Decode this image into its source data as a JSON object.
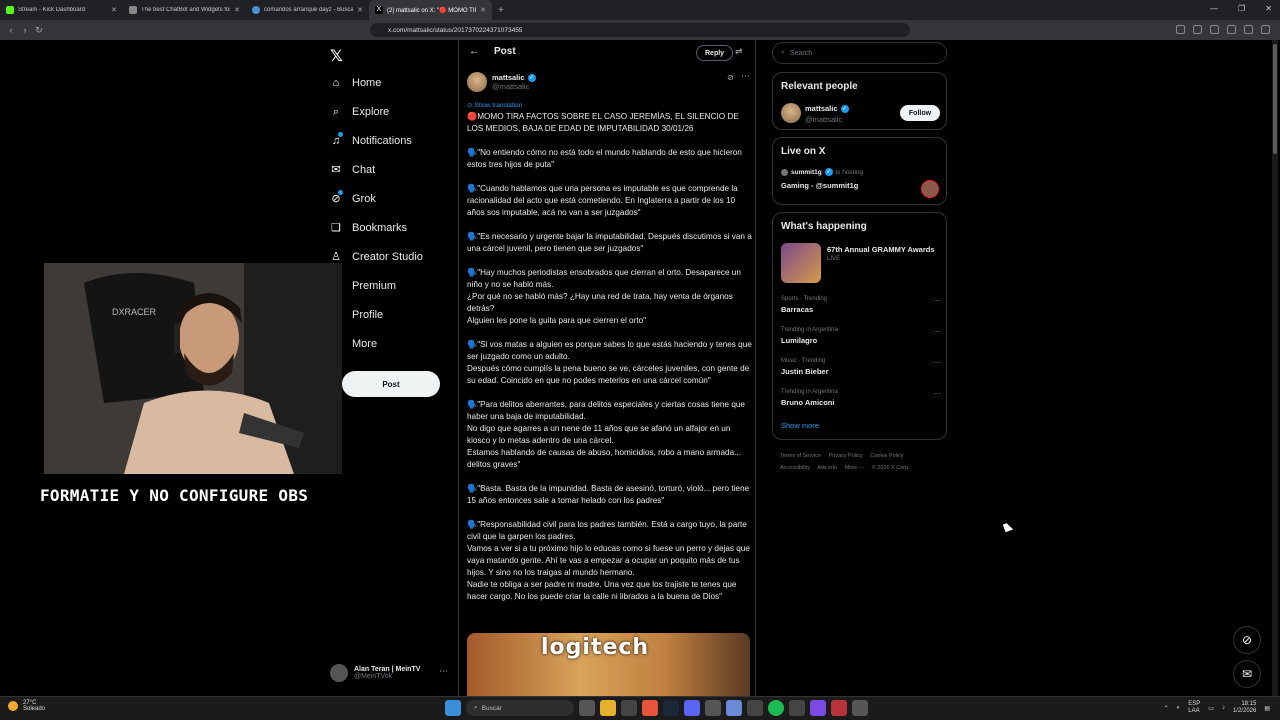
{
  "browser": {
    "tabs": [
      {
        "title": "Stream - Kick Dashboard",
        "color": "#53fc18"
      },
      {
        "title": "The best ChatBot and Widgets for K…",
        "color": "#888888"
      },
      {
        "title": "comandos arranque dayz - Buscar c…",
        "color": "#4a90d9"
      },
      {
        "title": "(2) mattsalic on X: \"🔴 MOMO TIR…",
        "color": "#ffffff",
        "active": true
      }
    ],
    "url": "x.com/mattsalic/status/2017370224371073455"
  },
  "nav": {
    "items": [
      {
        "label": "Home",
        "icon": "⌂"
      },
      {
        "label": "Explore",
        "icon": "⌕"
      },
      {
        "label": "Notifications",
        "icon": "♫"
      },
      {
        "label": "Chat",
        "icon": "✉"
      },
      {
        "label": "Grok",
        "icon": "⊘"
      },
      {
        "label": "Bookmarks",
        "icon": "❏"
      },
      {
        "label": "Creator Studio",
        "icon": "♙"
      },
      {
        "label": "Premium",
        "icon": "✕"
      },
      {
        "label": "Profile",
        "icon": "☺"
      },
      {
        "label": "More",
        "icon": "⋯"
      }
    ],
    "post_button": "Post",
    "account": {
      "name": "Alan Teran | MeinTV",
      "handle": "@MeinTVok"
    }
  },
  "overlay": {
    "caption": "FORMATIE Y NO CONFIGURE OBS"
  },
  "post": {
    "header_title": "Post",
    "reply_label": "Reply",
    "author": {
      "name": "mattsalic",
      "handle": "@mattsalic"
    },
    "show_translation": "Show translation",
    "paragraphs": [
      "🔴MOMO TIRA FACTOS SOBRE EL CASO JEREMÍAS, EL SILENCIO DE LOS MEDIOS, BAJA DE EDAD DE IMPUTABILIDAD 30/01/26",
      "🗣️\"No entiendo cómo no está todo el mundo hablando de esto que hicieron estos tres hijos de puta\"",
      "🗣️\"Cuando hablamos que una persona es imputable es que comprende la racionalidad del acto que está cometiendo. En Inglaterra a partir de los 10 años sos imputable, acá no van a ser juzgados\"",
      "🗣️\"Es necesario y urgente bajar la imputabilidad. Después discutimos si van a una cárcel juvenil, pero tienen que ser juzgados\"",
      "🗣️\"Hay muchos periodistas ensobrados que cierran el orto. Desaparece un niño y no se habló más.\n¿Por qué no se habló más? ¿Hay una red de trata, hay venta de órganos detrás?\nAlguien les pone la guita para que cierren el orto\"",
      "🗣️\"Si vos matas a alguien es porque sabes lo que estás haciendo y tenes que ser juzgado como un adulto.\nDespués cómo cumplís la pena bueno se ve, cárceles juveniles, con gente de su edad. Coincido en que no podes meterlos en una cárcel común\"",
      "🗣️\"Para delitos aberrantes, para delitos especiales y ciertas cosas tiene que haber una baja de imputabilidad.\nNo digo que agarres a un nene de 11 años que se afanó un alfajor en un kiosco y lo metas adentro de una cárcel.\nEstamos hablando de causas de abuso, homicidios, robo a mano armada... delitos graves\"",
      "🗣️\"Basta. Basta de la impunidad. Basta de asesinó, torturó, violó... pero tiene 15 años entonces sale a tomar helado con los padres\"",
      "🗣️\"Responsabilidad civil para los padres también. Está a cargo tuyo, la parte civil que la garpen los padres.\nVamos a ver si a tu próximo hijo lo educas como si fuese un perro y dejas que vaya matando gente. Ahí te vas a empezar a ocupar un poquito más de tus hijos. Y sino no los traigas al mundo hermano.\nNadie te obliga a ser padre ni madre. Una vez que los trajiste te tenes que hacer cargo. No los puede criar la calle ni librados a la buena de Dios\""
    ],
    "image_text": "logitech"
  },
  "sidebar": {
    "search_placeholder": "Search",
    "relevant": {
      "title": "Relevant people",
      "name": "mattsalic",
      "handle": "@mattsalic",
      "follow": "Follow"
    },
    "live": {
      "title": "Live on X",
      "host": "summit1g",
      "hosting": "is hosting",
      "stream": "Gaming - @summit1g"
    },
    "happening": {
      "title": "What's happening",
      "event": "67th Annual GRAMMY Awards",
      "event_status": "LIVE",
      "trends": [
        {
          "meta": "Sports · Trending",
          "name": "Barracas"
        },
        {
          "meta": "Trending in Argentina",
          "name": "Lumilagro"
        },
        {
          "meta": "Music · Trending",
          "name": "Justin Bieber"
        },
        {
          "meta": "Trending in Argentina",
          "name": "Bruno Amiconi"
        }
      ],
      "show_more": "Show more"
    },
    "footer": [
      "Terms of Service",
      "Privacy Policy",
      "Cookie Policy",
      "Accessibility",
      "Ads info",
      "More ···",
      "© 2026 X Corp."
    ]
  },
  "taskbar": {
    "weather_temp": "27°C",
    "weather_desc": "Soleado",
    "search": "Buscar",
    "lang": "ESP",
    "lang2": "LAA",
    "time": "18:15",
    "date": "1/2/2026"
  }
}
